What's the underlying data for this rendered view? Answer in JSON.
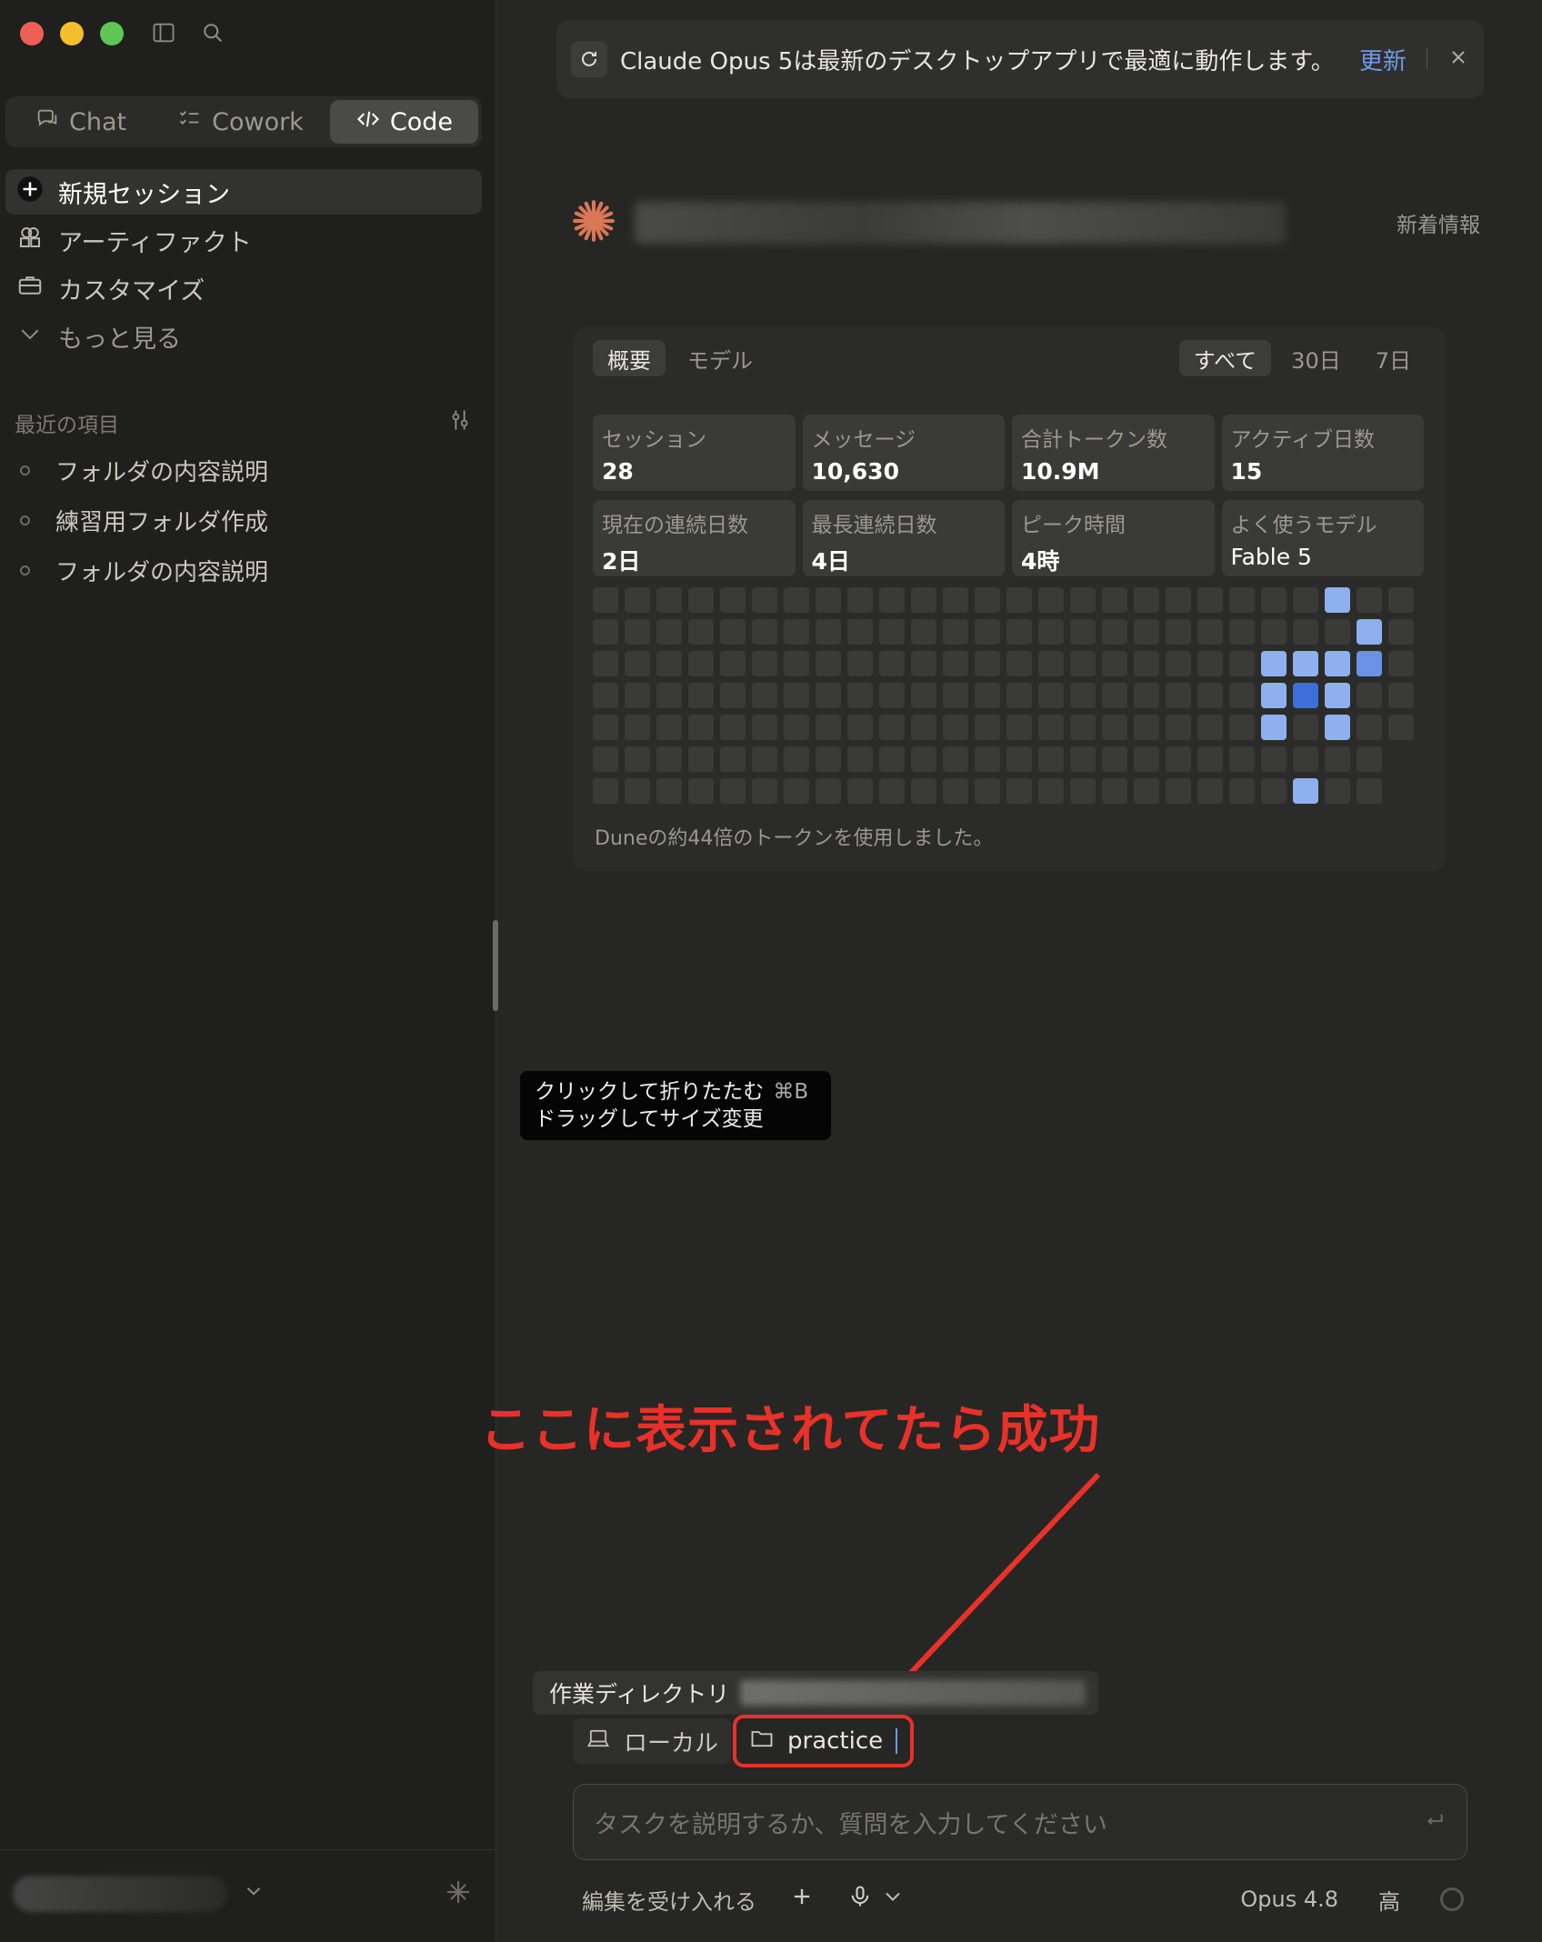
{
  "sidebar": {
    "modes": [
      {
        "label": "Chat",
        "icon": "chat-icon",
        "active": false
      },
      {
        "label": "Cowork",
        "icon": "checklist-icon",
        "active": false
      },
      {
        "label": "Code",
        "icon": "code-icon",
        "active": true
      }
    ],
    "nav": [
      {
        "label": "新規セッション",
        "icon": "plus-icon"
      },
      {
        "label": "アーティファクト",
        "icon": "artifact-icon"
      },
      {
        "label": "カスタマイズ",
        "icon": "briefcase-icon"
      },
      {
        "label": "もっと見る",
        "icon": "chevron-down-icon"
      }
    ],
    "recent_title": "最近の項目",
    "recent": [
      "フォルダの内容説明",
      "練習用フォルダ作成",
      "フォルダの内容説明"
    ]
  },
  "banner": {
    "text": "Claude Opus 5は最新のデスクトップアプリで最適に動作します。",
    "update": "更新"
  },
  "header": {
    "whats_new": "新着情報"
  },
  "stats": {
    "tabs": [
      "概要",
      "モデル"
    ],
    "ranges": [
      "すべて",
      "30日",
      "7日"
    ],
    "cards": [
      {
        "label": "セッション",
        "value": "28"
      },
      {
        "label": "メッセージ",
        "value": "10,630"
      },
      {
        "label": "合計トークン数",
        "value": "10.9M"
      },
      {
        "label": "アクティブ日数",
        "value": "15"
      },
      {
        "label": "現在の連続日数",
        "value": "2日"
      },
      {
        "label": "最長連続日数",
        "value": "4日"
      },
      {
        "label": "ピーク時間",
        "value": "4時"
      },
      {
        "label": "よく使うモデル",
        "value": "Fable 5"
      }
    ],
    "heatmap_rows": [
      "0000000000000000000000010000",
      "000000000000000000000000101",
      "000000000000000000000111200",
      "000000000000000000000131001",
      "000000000000000000000101001",
      "0000000000000000000000000n",
      "0000000000000000000000100n"
    ],
    "note": "Duneの約44倍のトークンを使用しました。"
  },
  "tooltip": {
    "line1": "クリックして折りたたむ",
    "shortcut": "⌘B",
    "line2": "ドラッグしてサイズ変更"
  },
  "annotation": {
    "text": "ここに表示されてたら成功",
    "color": "#e83129"
  },
  "composer": {
    "workdir_label": "作業ディレクトリ",
    "location": "ローカル",
    "folder": "practice",
    "placeholder": "タスクを説明するか、質問を入力してください",
    "accept_edits": "編集を受け入れる",
    "model": "Opus 4.8",
    "effort": "高"
  }
}
